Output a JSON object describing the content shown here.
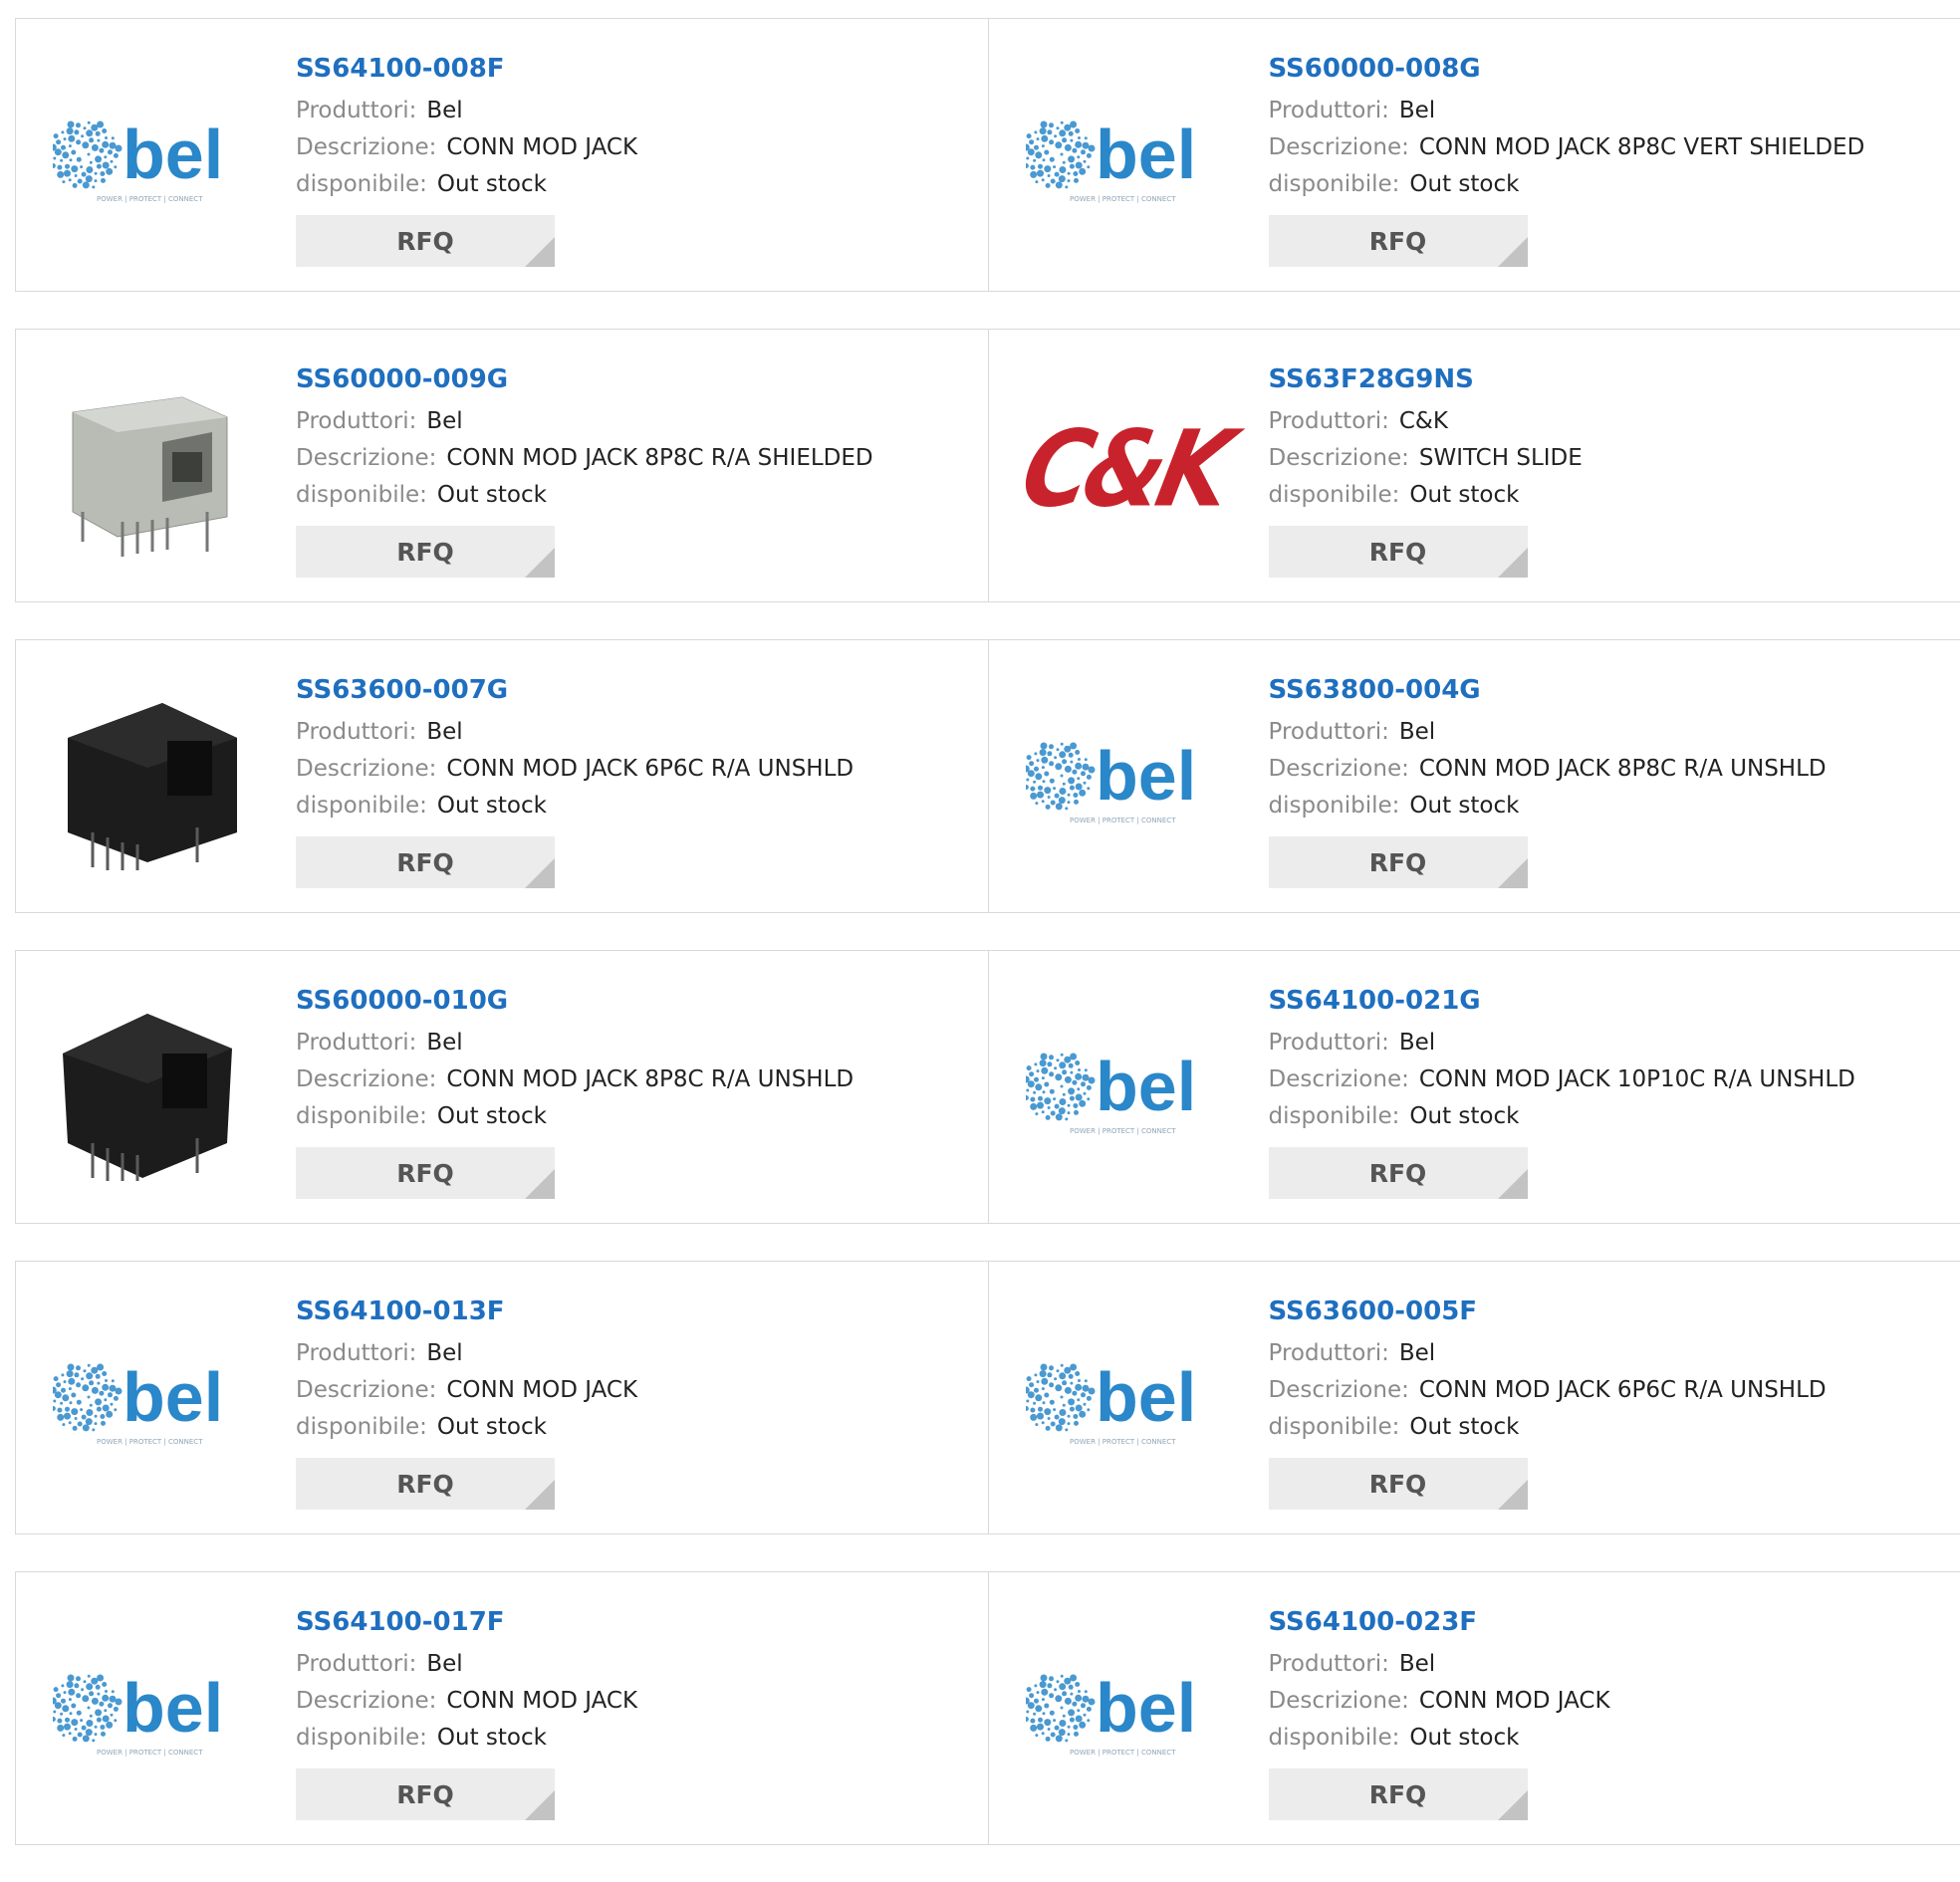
{
  "labels": {
    "manufacturer": "Produttori:",
    "description": "Descrizione:",
    "availability": "disponibile:",
    "rfq": "RFQ"
  },
  "logos": {
    "bel_text": "bel",
    "bel_tagline": "POWER | PROTECT | CONNECT",
    "ck_text": "C&K"
  },
  "colors": {
    "part_link": "#1f6fbf",
    "bel_blue": "#2a87c9",
    "ck_red": "#c8232c"
  },
  "products": [
    {
      "part": "SS64100-008F",
      "manufacturer": "Bel",
      "description": "CONN MOD JACK",
      "availability": "Out stock",
      "image": "bel-logo"
    },
    {
      "part": "SS60000-008G",
      "manufacturer": "Bel",
      "description": "CONN MOD JACK 8P8C VERT SHIELDED",
      "availability": "Out stock",
      "image": "bel-logo"
    },
    {
      "part": "SS60000-009G",
      "manufacturer": "Bel",
      "description": "CONN MOD JACK 8P8C R/A SHIELDED",
      "availability": "Out stock",
      "image": "shielded-jack-photo"
    },
    {
      "part": "SS63F28G9NS",
      "manufacturer": "C&K",
      "description": "SWITCH SLIDE",
      "availability": "Out stock",
      "image": "ck-logo"
    },
    {
      "part": "SS63600-007G",
      "manufacturer": "Bel",
      "description": "CONN MOD JACK 6P6C R/A UNSHLD",
      "availability": "Out stock",
      "image": "black-jack-photo"
    },
    {
      "part": "SS63800-004G",
      "manufacturer": "Bel",
      "description": "CONN MOD JACK 8P8C R/A UNSHLD",
      "availability": "Out stock",
      "image": "bel-logo"
    },
    {
      "part": "SS60000-010G",
      "manufacturer": "Bel",
      "description": "CONN MOD JACK 8P8C R/A UNSHLD",
      "availability": "Out stock",
      "image": "black-jack-angled-photo"
    },
    {
      "part": "SS64100-021G",
      "manufacturer": "Bel",
      "description": "CONN MOD JACK 10P10C R/A UNSHLD",
      "availability": "Out stock",
      "image": "bel-logo"
    },
    {
      "part": "SS64100-013F",
      "manufacturer": "Bel",
      "description": "CONN MOD JACK",
      "availability": "Out stock",
      "image": "bel-logo"
    },
    {
      "part": "SS63600-005F",
      "manufacturer": "Bel",
      "description": "CONN MOD JACK 6P6C R/A UNSHLD",
      "availability": "Out stock",
      "image": "bel-logo"
    },
    {
      "part": "SS64100-017F",
      "manufacturer": "Bel",
      "description": "CONN MOD JACK",
      "availability": "Out stock",
      "image": "bel-logo"
    },
    {
      "part": "SS64100-023F",
      "manufacturer": "Bel",
      "description": "CONN MOD JACK",
      "availability": "Out stock",
      "image": "bel-logo"
    }
  ]
}
